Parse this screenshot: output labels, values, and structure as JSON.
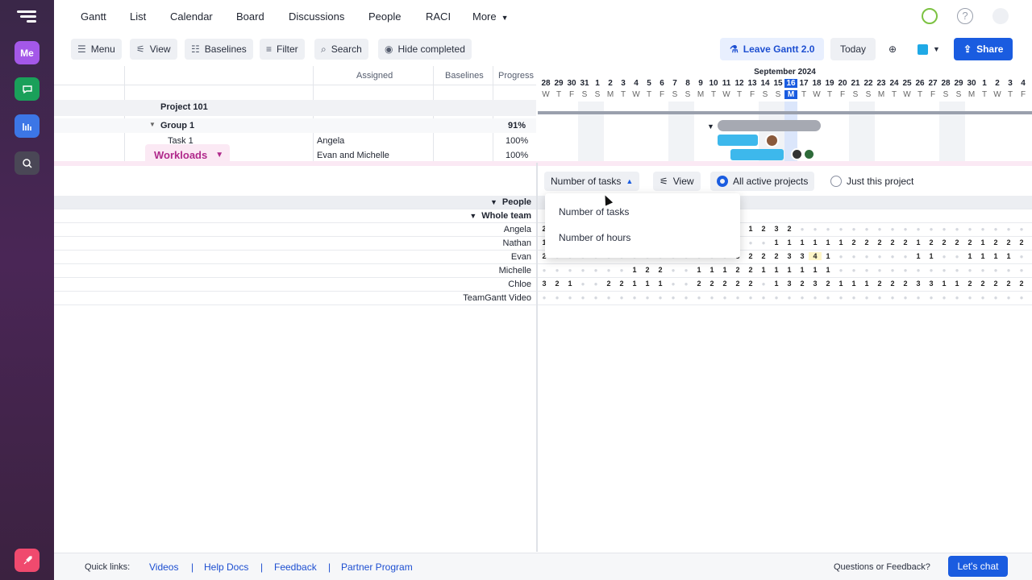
{
  "rail": {
    "me_label": "Me"
  },
  "topnav": {
    "items": [
      "Gantt",
      "List",
      "Calendar",
      "Board",
      "Discussions",
      "People",
      "RACI"
    ],
    "more_label": "More"
  },
  "toolbar": {
    "menu": "Menu",
    "view": "View",
    "baselines": "Baselines",
    "filter": "Filter",
    "search": "Search",
    "hide_completed": "Hide completed",
    "leave_gantt": "Leave Gantt 2.0",
    "today": "Today",
    "share": "Share",
    "accent": "#1a5ce0"
  },
  "grid": {
    "headers": {
      "assigned": "Assigned",
      "baselines": "Baselines",
      "progress": "Progress"
    },
    "rows": [
      {
        "name": "Project 101",
        "assigned": "",
        "progress": ""
      },
      {
        "name": "Group 1",
        "assigned": "",
        "progress": "91%"
      },
      {
        "name": "Task 1",
        "assigned": "Angela",
        "progress": "100%"
      },
      {
        "name": "",
        "assigned": "Evan and Michelle",
        "progress": "100%"
      }
    ]
  },
  "timeline": {
    "month": "September 2024",
    "days": [
      "28",
      "29",
      "30",
      "31",
      "1",
      "2",
      "3",
      "4",
      "5",
      "6",
      "7",
      "8",
      "9",
      "10",
      "11",
      "12",
      "13",
      "14",
      "15",
      "16",
      "17",
      "18",
      "19",
      "20",
      "21",
      "22",
      "23",
      "24",
      "25",
      "26",
      "27",
      "28",
      "29",
      "30",
      "1",
      "2",
      "3",
      "4"
    ],
    "weekdays": [
      "W",
      "T",
      "F",
      "S",
      "S",
      "M",
      "T",
      "W",
      "T",
      "F",
      "S",
      "S",
      "M",
      "T",
      "W",
      "T",
      "F",
      "S",
      "S",
      "M",
      "T",
      "W",
      "T",
      "F",
      "S",
      "S",
      "M",
      "T",
      "W",
      "T",
      "F",
      "S",
      "S",
      "M",
      "T",
      "W",
      "T",
      "F"
    ],
    "today": "16"
  },
  "workloads": {
    "tab_label": "Workloads",
    "metric_label": "Number of tasks",
    "view_label": "View",
    "radio_all": "All active projects",
    "radio_this": "Just this project",
    "dropdown_options": [
      "Number of tasks",
      "Number of hours"
    ],
    "people_label": "People",
    "team_label": "Whole team",
    "people": [
      "Angela",
      "Nathan",
      "Evan",
      "Michelle",
      "Chloe",
      "TeamGantt Video"
    ],
    "values": [
      [
        "2",
        "",
        "",
        "",
        "",
        "",
        "",
        "",
        "",
        "",
        "",
        "",
        "",
        "",
        "",
        "3",
        "1",
        "2",
        "3",
        "2",
        "",
        "",
        "",
        "",
        "",
        "",
        "",
        "",
        "",
        "",
        "",
        "",
        "",
        "",
        "",
        "",
        "",
        ""
      ],
      [
        "1",
        "",
        "",
        "",
        "",
        "",
        "",
        "",
        "",
        "",
        "",
        "",
        "",
        "",
        "",
        "1",
        "",
        "",
        "1",
        "1",
        "1",
        "1",
        "1",
        "1",
        "2",
        "2",
        "2",
        "2",
        "2",
        "1",
        "2",
        "2",
        "2",
        "2",
        "1",
        "2",
        "2",
        "2"
      ],
      [
        "2",
        "",
        "",
        "",
        "",
        "",
        "",
        "",
        "",
        "",
        "",
        "",
        "",
        "",
        "",
        "3",
        "2",
        "2",
        "2",
        "3",
        "3",
        "4",
        "1",
        "",
        "",
        "",
        "",
        "",
        "",
        "1",
        "1",
        "",
        "",
        "1",
        "1",
        "1",
        "1",
        ""
      ],
      [
        "",
        "",
        "",
        "",
        "",
        "",
        "",
        "1",
        "2",
        "2",
        "",
        "",
        "1",
        "1",
        "1",
        "2",
        "2",
        "1",
        "1",
        "1",
        "1",
        "1",
        "1",
        "",
        "",
        "",
        "",
        "",
        "",
        "",
        "",
        "",
        "",
        "",
        "",
        "",
        "",
        ""
      ],
      [
        "3",
        "2",
        "1",
        "",
        "",
        "2",
        "2",
        "1",
        "1",
        "1",
        "",
        "",
        "2",
        "2",
        "2",
        "2",
        "2",
        "",
        "1",
        "3",
        "2",
        "3",
        "2",
        "1",
        "1",
        "1",
        "2",
        "2",
        "2",
        "3",
        "3",
        "1",
        "1",
        "2",
        "2",
        "2",
        "2",
        "2"
      ],
      [
        "",
        "",
        "",
        "",
        "",
        "",
        "",
        "",
        "",
        "",
        "",
        "",
        "",
        "",
        "",
        "",
        "",
        "",
        "",
        "",
        "",
        "",
        "",
        "",
        "",
        "",
        "",
        "",
        "",
        "",
        "",
        "",
        "",
        "",
        "",
        "",
        "",
        ""
      ]
    ]
  },
  "footer": {
    "quick_links": "Quick links:",
    "links": [
      "Videos",
      "Help Docs",
      "Feedback",
      "Partner Program"
    ],
    "questions": "Questions or Feedback?",
    "chat": "Let's chat"
  }
}
